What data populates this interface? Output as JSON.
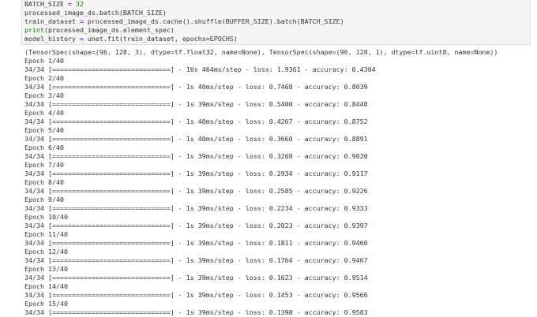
{
  "code_cell": {
    "lines": [
      [
        {
          "t": "BATCH_SIZE ",
          "c": "txt"
        },
        {
          "t": "=",
          "c": "op"
        },
        {
          "t": " ",
          "c": "txt"
        },
        {
          "t": "32",
          "c": "num"
        }
      ],
      [
        {
          "t": "processed_image_ds.batch(BATCH_SIZE)",
          "c": "txt"
        }
      ],
      [
        {
          "t": "train_dataset ",
          "c": "txt"
        },
        {
          "t": "=",
          "c": "op"
        },
        {
          "t": " processed_image_ds.cache().shuffle(BUFFER_SIZE).batch(BATCH_SIZE)",
          "c": "txt"
        }
      ],
      [
        {
          "t": "print",
          "c": "kw"
        },
        {
          "t": "(processed_image_ds.element_spec)",
          "c": "txt"
        }
      ],
      [
        {
          "t": "model_history ",
          "c": "txt"
        },
        {
          "t": "=",
          "c": "op"
        },
        {
          "t": " unet.fit(train_dataset, epochs",
          "c": "txt"
        },
        {
          "t": "=",
          "c": "op"
        },
        {
          "t": "EPOCHS)",
          "c": "txt"
        }
      ]
    ]
  },
  "output": {
    "lines": [
      "(TensorSpec(shape=(96, 128, 3), dtype=tf.float32, name=None), TensorSpec(shape=(96, 128, 1), dtype=tf.uint8, name=None))",
      "Epoch 1/40",
      "34/34 [==============================] - 16s 464ms/step - loss: 1.9361 - accuracy: 0.4304",
      "Epoch 2/40",
      "34/34 [==============================] - 1s 40ms/step - loss: 0.7468 - accuracy: 0.8039",
      "Epoch 3/40",
      "34/34 [==============================] - 1s 39ms/step - loss: 0.5400 - accuracy: 0.8440",
      "Epoch 4/40",
      "34/34 [==============================] - 1s 40ms/step - loss: 0.4267 - accuracy: 0.8752",
      "Epoch 5/40",
      "34/34 [==============================] - 1s 40ms/step - loss: 0.3660 - accuracy: 0.8891",
      "Epoch 6/40",
      "34/34 [==============================] - 1s 39ms/step - loss: 0.3268 - accuracy: 0.9020",
      "Epoch 7/40",
      "34/34 [==============================] - 1s 39ms/step - loss: 0.2934 - accuracy: 0.9117",
      "Epoch 8/40",
      "34/34 [==============================] - 1s 39ms/step - loss: 0.2585 - accuracy: 0.9226",
      "Epoch 9/40",
      "34/34 [==============================] - 1s 39ms/step - loss: 0.2234 - accuracy: 0.9333",
      "Epoch 10/40",
      "34/34 [==============================] - 1s 39ms/step - loss: 0.2023 - accuracy: 0.9397",
      "Epoch 11/40",
      "34/34 [==============================] - 1s 39ms/step - loss: 0.1811 - accuracy: 0.9460",
      "Epoch 12/40",
      "34/34 [==============================] - 1s 39ms/step - loss: 0.1764 - accuracy: 0.9467",
      "Epoch 13/40",
      "34/34 [==============================] - 1s 39ms/step - loss: 0.1623 - accuracy: 0.9514",
      "Epoch 14/40",
      "34/34 [==============================] - 1s 39ms/step - loss: 0.1453 - accuracy: 0.9566",
      "Epoch 15/40",
      "34/34 [==============================] - 1s 39ms/step - loss: 0.1398 - accuracy: 0.9583"
    ]
  }
}
